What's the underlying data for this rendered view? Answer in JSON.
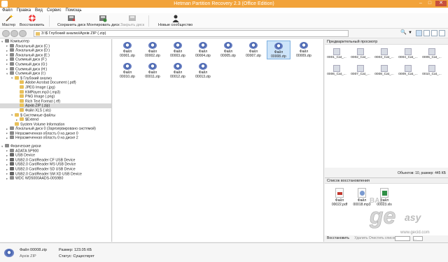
{
  "window": {
    "title": "Hetman Partition Recovery 2.3 (Office Edition)"
  },
  "menu": [
    "Файл",
    "Правка",
    "Вид",
    "Сервис",
    "Помощь"
  ],
  "toolbar": {
    "wizard": "Мастер",
    "restore": "Восстановить",
    "save_disk": "Сохранить диск",
    "mount_disk": "Монтировать диск",
    "close_disk": "Закрыть диск",
    "new_message": "Новые сообщество"
  },
  "address": {
    "path": "3:\\$ Глубокий анализ\\Архів ZIP (.zip)"
  },
  "tree": [
    {
      "label": "Компьютер",
      "level": 0,
      "exp": "▾",
      "icon": "pc"
    },
    {
      "label": "Локальный диск (C:)",
      "level": 1,
      "exp": "▸",
      "icon": "disk"
    },
    {
      "label": "Локальный диск (D:)",
      "level": 1,
      "exp": "▸",
      "icon": "disk"
    },
    {
      "label": "Локальный диск (E:)",
      "level": 1,
      "exp": "▸",
      "icon": "disk"
    },
    {
      "label": "Съемный диск (F:)",
      "level": 1,
      "exp": "▸",
      "icon": "disk"
    },
    {
      "label": "Съемный диск (G:)",
      "level": 1,
      "exp": "▸",
      "icon": "disk"
    },
    {
      "label": "Съемный диск (H:)",
      "level": 1,
      "exp": "▸",
      "icon": "disk"
    },
    {
      "label": "Съемный диск (I:)",
      "level": 1,
      "exp": "▾",
      "icon": "disk"
    },
    {
      "label": "$ Глубокий анализ",
      "level": 2,
      "exp": "▾",
      "icon": "folder"
    },
    {
      "label": "Adobe Acrobat Document (.pdf)",
      "level": 3,
      "exp": "",
      "icon": "folder"
    },
    {
      "label": "JPEG Image (.jpg)",
      "level": 3,
      "exp": "",
      "icon": "folder"
    },
    {
      "label": "KMPlayer.mp3 (.mp3)",
      "level": 3,
      "exp": "",
      "icon": "folder"
    },
    {
      "label": "PNG Image (.png)",
      "level": 3,
      "exp": "",
      "icon": "folder"
    },
    {
      "label": "Rich Text Format (.rtf)",
      "level": 3,
      "exp": "",
      "icon": "folder"
    },
    {
      "label": "Архів ZIP (.zip)",
      "level": 3,
      "exp": "",
      "icon": "folder",
      "selected": true
    },
    {
      "label": "Файл XLS (.xls)",
      "level": 3,
      "exp": "",
      "icon": "folder"
    },
    {
      "label": "$ Системные файлы",
      "level": 2,
      "exp": "▾",
      "icon": "folder"
    },
    {
      "label": "$Extend",
      "level": 3,
      "exp": "▸",
      "icon": "folder"
    },
    {
      "label": "System Volume Information",
      "level": 2,
      "exp": "",
      "icon": "folder"
    },
    {
      "label": "Локальный диск 0 (Зарезервировано системой)",
      "level": 1,
      "exp": "▸",
      "icon": "disk"
    },
    {
      "label": "Неразмеченная область 0 на диске 0",
      "level": 1,
      "exp": "▸",
      "icon": "disk"
    },
    {
      "label": "Неразмеченная область 0 на диске 2",
      "level": 1,
      "exp": "▸",
      "icon": "disk"
    }
  ],
  "tree_physical": [
    {
      "label": "Физические диски",
      "level": 0,
      "exp": "▾",
      "icon": "pc"
    },
    {
      "label": "ADATA SP900",
      "level": 1,
      "exp": "▸",
      "icon": "disk"
    },
    {
      "label": "USB Device",
      "level": 1,
      "exp": "▸",
      "icon": "usb"
    },
    {
      "label": "USB2.0 CardReader CF USB Device",
      "level": 1,
      "exp": "▸",
      "icon": "usb"
    },
    {
      "label": "USB2.0 CardReader MS USB Device",
      "level": 1,
      "exp": "▸",
      "icon": "usb"
    },
    {
      "label": "USB2.0 CardReader SD USB Device",
      "level": 1,
      "exp": "▸",
      "icon": "usb"
    },
    {
      "label": "USB2.0 CardReader SM XD USB Device",
      "level": 1,
      "exp": "▸",
      "icon": "usb"
    },
    {
      "label": "WDC WD5000AADS-00S9B0",
      "level": 1,
      "exp": "▸",
      "icon": "disk"
    }
  ],
  "files": [
    {
      "line1": "Файл",
      "line2": "00001.zip"
    },
    {
      "line1": "Файл",
      "line2": "00002.zip"
    },
    {
      "line1": "Файл",
      "line2": "00003.zip"
    },
    {
      "line1": "Файл",
      "line2": "00004.zip"
    },
    {
      "line1": "Файл",
      "line2": "00005.zip"
    },
    {
      "line1": "Файл",
      "line2": "00007.zip"
    },
    {
      "line1": "Файл",
      "line2": "00008.zip",
      "selected": true
    },
    {
      "line1": "Файл",
      "line2": "00009.zip"
    },
    {
      "line1": "Файл",
      "line2": "00010.zip"
    },
    {
      "line1": "Файл",
      "line2": "00011.zip"
    },
    {
      "line1": "Файл",
      "line2": "00012.zip"
    },
    {
      "line1": "Файл",
      "line2": "00013.zip"
    }
  ],
  "preview": {
    "title": "Предварительный просмотр",
    "items": [
      "0001_Cat_...",
      "0002_Cat_...",
      "0003_Cat_...",
      "0004_Cat_...",
      "0005_Cat_...",
      "0006_Cat_...",
      "0007_Cat_...",
      "0008_Cat_...",
      "0009_Cat_...",
      "0010_Cat_..."
    ]
  },
  "objects_info": "Объектов: 10, размер: 445 КБ",
  "recovery": {
    "title": "Список восстановления",
    "items": [
      {
        "name": "Файл 00022.pdf",
        "kind": "pdf"
      },
      {
        "name": "Файл 00018.mp3",
        "kind": "mp3"
      },
      {
        "name": "Файл 00023.xls",
        "kind": "xls"
      }
    ],
    "footer_restore": "Восстановить",
    "footer_clear": "Удалить  Очистить список",
    "footer_sort": "..."
  },
  "status": {
    "name": "Файл 00008.zip",
    "type": "Архів ZIP",
    "size_label": "Размер: 123.05 КБ",
    "state_label": "Статус: Существует"
  },
  "watermark": {
    "text": "www.gecid.com"
  }
}
